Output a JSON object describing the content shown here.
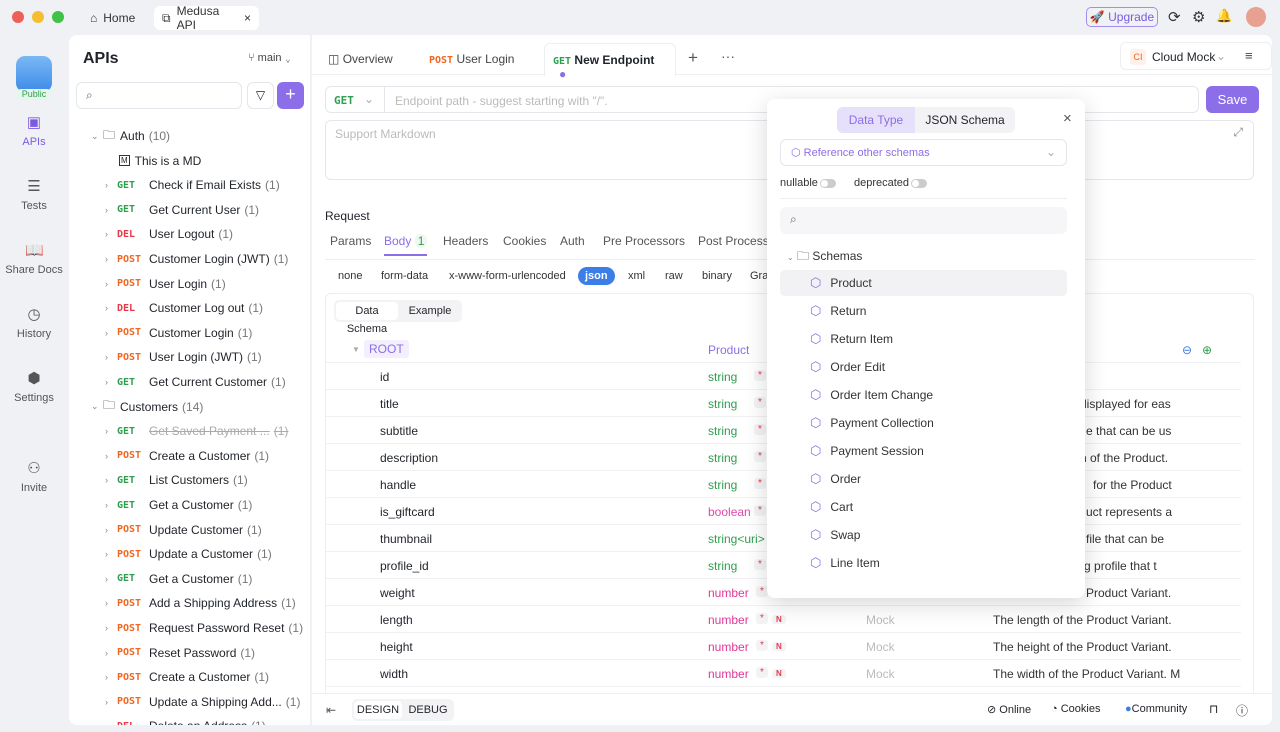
{
  "window": {
    "tabs": [
      {
        "label": "Home",
        "icon": "home-icon"
      },
      {
        "label": "Medusa API",
        "icon": "external-icon"
      }
    ],
    "upgrade": "Upgrade"
  },
  "rail": {
    "badge": "Public",
    "items": [
      {
        "label": "APIs",
        "icon": "apis-icon"
      },
      {
        "label": "Tests",
        "icon": "tests-icon"
      },
      {
        "label": "Share Docs",
        "icon": "book-icon"
      },
      {
        "label": "History",
        "icon": "clock-icon"
      },
      {
        "label": "Settings",
        "icon": "gear-icon"
      },
      {
        "label": "Invite",
        "icon": "user-plus-icon"
      }
    ]
  },
  "sidebar": {
    "title": "APIs",
    "branch": "main",
    "folders": [
      {
        "name": "Auth",
        "count": "(10)",
        "doc": "This is a MD",
        "items": [
          [
            "GET",
            "Check if Email Exists",
            "(1)"
          ],
          [
            "GET",
            "Get Current User",
            "(1)"
          ],
          [
            "DEL",
            "User Logout",
            "(1)"
          ],
          [
            "POST",
            "Customer Login (JWT)",
            "(1)"
          ],
          [
            "POST",
            "User Login",
            "(1)"
          ],
          [
            "DEL",
            "Customer Log out",
            "(1)"
          ],
          [
            "POST",
            "Customer Login",
            "(1)"
          ],
          [
            "POST",
            "User Login (JWT)",
            "(1)"
          ],
          [
            "GET",
            "Get Current Customer",
            "(1)"
          ]
        ]
      },
      {
        "name": "Customers",
        "count": "(14)",
        "items": [
          [
            "GET",
            "Get Saved Payment ...",
            "(1)"
          ],
          [
            "POST",
            "Create a Customer",
            "(1)"
          ],
          [
            "GET",
            "List Customers",
            "(1)"
          ],
          [
            "GET",
            "Get a Customer",
            "(1)"
          ],
          [
            "POST",
            "Update Customer",
            "(1)"
          ],
          [
            "POST",
            "Update a Customer",
            "(1)"
          ],
          [
            "GET",
            "Get a Customer",
            "(1)"
          ],
          [
            "POST",
            "Add a Shipping Address",
            "(1)"
          ],
          [
            "POST",
            "Request Password Reset",
            "(1)"
          ],
          [
            "POST",
            "Reset Password",
            "(1)"
          ],
          [
            "POST",
            "Create a Customer",
            "(1)"
          ],
          [
            "POST",
            "Update a Shipping Add...",
            "(1)"
          ],
          [
            "DEL",
            "Delete an Address",
            "(1)"
          ]
        ]
      }
    ]
  },
  "main": {
    "tabs": [
      {
        "method": "",
        "label": "Overview"
      },
      {
        "method": "POST",
        "label": "User Login"
      },
      {
        "method": "GET",
        "label": "New Endpoint"
      }
    ],
    "env": "Cloud Mock",
    "env_badge": "CI",
    "method": "GET",
    "path_placeholder": "Endpoint path - suggest starting with \"/\".",
    "save": "Save",
    "markdown_placeholder": "Support Markdown",
    "request_label": "Request",
    "req_tabs": [
      "Params",
      "Body",
      "Headers",
      "Cookies",
      "Auth",
      "Pre Processors",
      "Post Process"
    ],
    "body_count": "1",
    "body_types": [
      "none",
      "form-data",
      "x-www-form-urlencoded",
      "json",
      "xml",
      "raw",
      "binary",
      "Gra"
    ],
    "selected_body": "json",
    "schema_tabs": [
      "Data Schema",
      "Example"
    ],
    "root": {
      "name": "ROOT",
      "type": "Product"
    },
    "fields": [
      {
        "name": "id",
        "type": "string",
        "req": "*",
        "desc": ""
      },
      {
        "name": "title",
        "type": "string",
        "req": "*",
        "desc": "displayed for eas"
      },
      {
        "name": "subtitle",
        "type": "string",
        "req": "*",
        "desc": "e that can be us"
      },
      {
        "name": "description",
        "type": "string",
        "req": "*",
        "desc": "n of the Product."
      },
      {
        "name": "handle",
        "type": "string",
        "req": "*",
        "desc": "for the Product"
      },
      {
        "name": "is_giftcard",
        "type": "boolean",
        "req": "*",
        "desc": "uct represents a"
      },
      {
        "name": "thumbnail",
        "type": "string<uri>",
        "req": "",
        "desc": "file that can be"
      },
      {
        "name": "profile_id",
        "type": "string",
        "req": "*",
        "desc": "ping profile that t"
      },
      {
        "name": "weight",
        "type": "number",
        "req": "*",
        "desc": "Product Variant."
      },
      {
        "name": "length",
        "type": "number",
        "req": "*",
        "n": "N",
        "mock": "Mock",
        "desc": "The length of the Product Variant."
      },
      {
        "name": "height",
        "type": "number",
        "req": "*",
        "n": "N",
        "mock": "Mock",
        "desc": "The height of the Product Variant."
      },
      {
        "name": "width",
        "type": "number",
        "req": "*",
        "n": "N",
        "mock": "Mock",
        "desc": "The width of the Product Variant. M"
      }
    ]
  },
  "popup": {
    "tabs": [
      "Data Type",
      "JSON Schema"
    ],
    "reference": "Reference other schemas",
    "nullable": "nullable",
    "deprecated": "deprecated",
    "folder": "Schemas",
    "schemas": [
      "Product",
      "Return",
      "Return Item",
      "Order Edit",
      "Order Item Change",
      "Payment Collection",
      "Payment Session",
      "Order",
      "Cart",
      "Swap",
      "Line Item"
    ]
  },
  "footer": {
    "modes": [
      "DESIGN",
      "DEBUG"
    ],
    "online": "Online",
    "cookies": "Cookies",
    "community": "Community"
  },
  "colors": {
    "accent": "#8b6ee8",
    "get": "#2e9e4f",
    "post": "#f0651f",
    "del": "#e5394a",
    "boolean": "#e048a8",
    "number": "#e0379a"
  }
}
